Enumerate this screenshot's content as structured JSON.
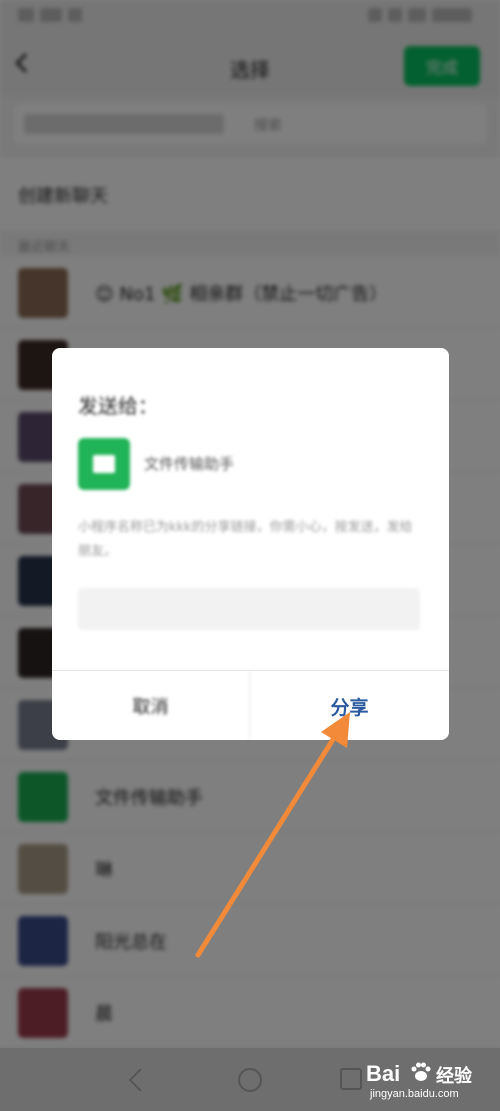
{
  "nav": {
    "title": "选择",
    "done_label": "完成"
  },
  "search": {
    "placeholder": "搜索"
  },
  "recent_section": {
    "title": "创建新聊天"
  },
  "list_header": "最近聊天",
  "chats": [
    {
      "name": "😊 No1 🌿 相亲群（禁止一切广告）",
      "avatar_color": "#8a6a55"
    },
    {
      "name": "",
      "avatar_color": "#3b2a25"
    },
    {
      "name": "",
      "avatar_color": "#5a4a6a"
    },
    {
      "name": "",
      "avatar_color": "#6e4a55"
    },
    {
      "name": "",
      "avatar_color": "#27324a"
    },
    {
      "name": "",
      "avatar_color": "#2c2422"
    },
    {
      "name": "",
      "avatar_color": "#7a7f90"
    },
    {
      "name": "文件传输助手",
      "avatar_color": "#1aad4f"
    },
    {
      "name": "琳",
      "avatar_color": "#a89a88"
    },
    {
      "name": "阳光总在",
      "avatar_color": "#3a4a8a"
    },
    {
      "name": "晨",
      "avatar_color": "#9a3a4a"
    }
  ],
  "dialog": {
    "title": "发送给：",
    "target_name": "文件传输助手",
    "description": "小程序名称已为kkk的分享链接，你需小心，按发送，发给朋友。",
    "message_placeholder": "",
    "cancel_label": "取消",
    "share_label": "分享"
  },
  "colors": {
    "accent_green": "#07c160",
    "share_text": "#2c5aa0",
    "arrow": "#f28a3a"
  },
  "watermark": {
    "brand": "Bai",
    "brand_cn": "经验",
    "url": "jingyan.baidu.com"
  }
}
